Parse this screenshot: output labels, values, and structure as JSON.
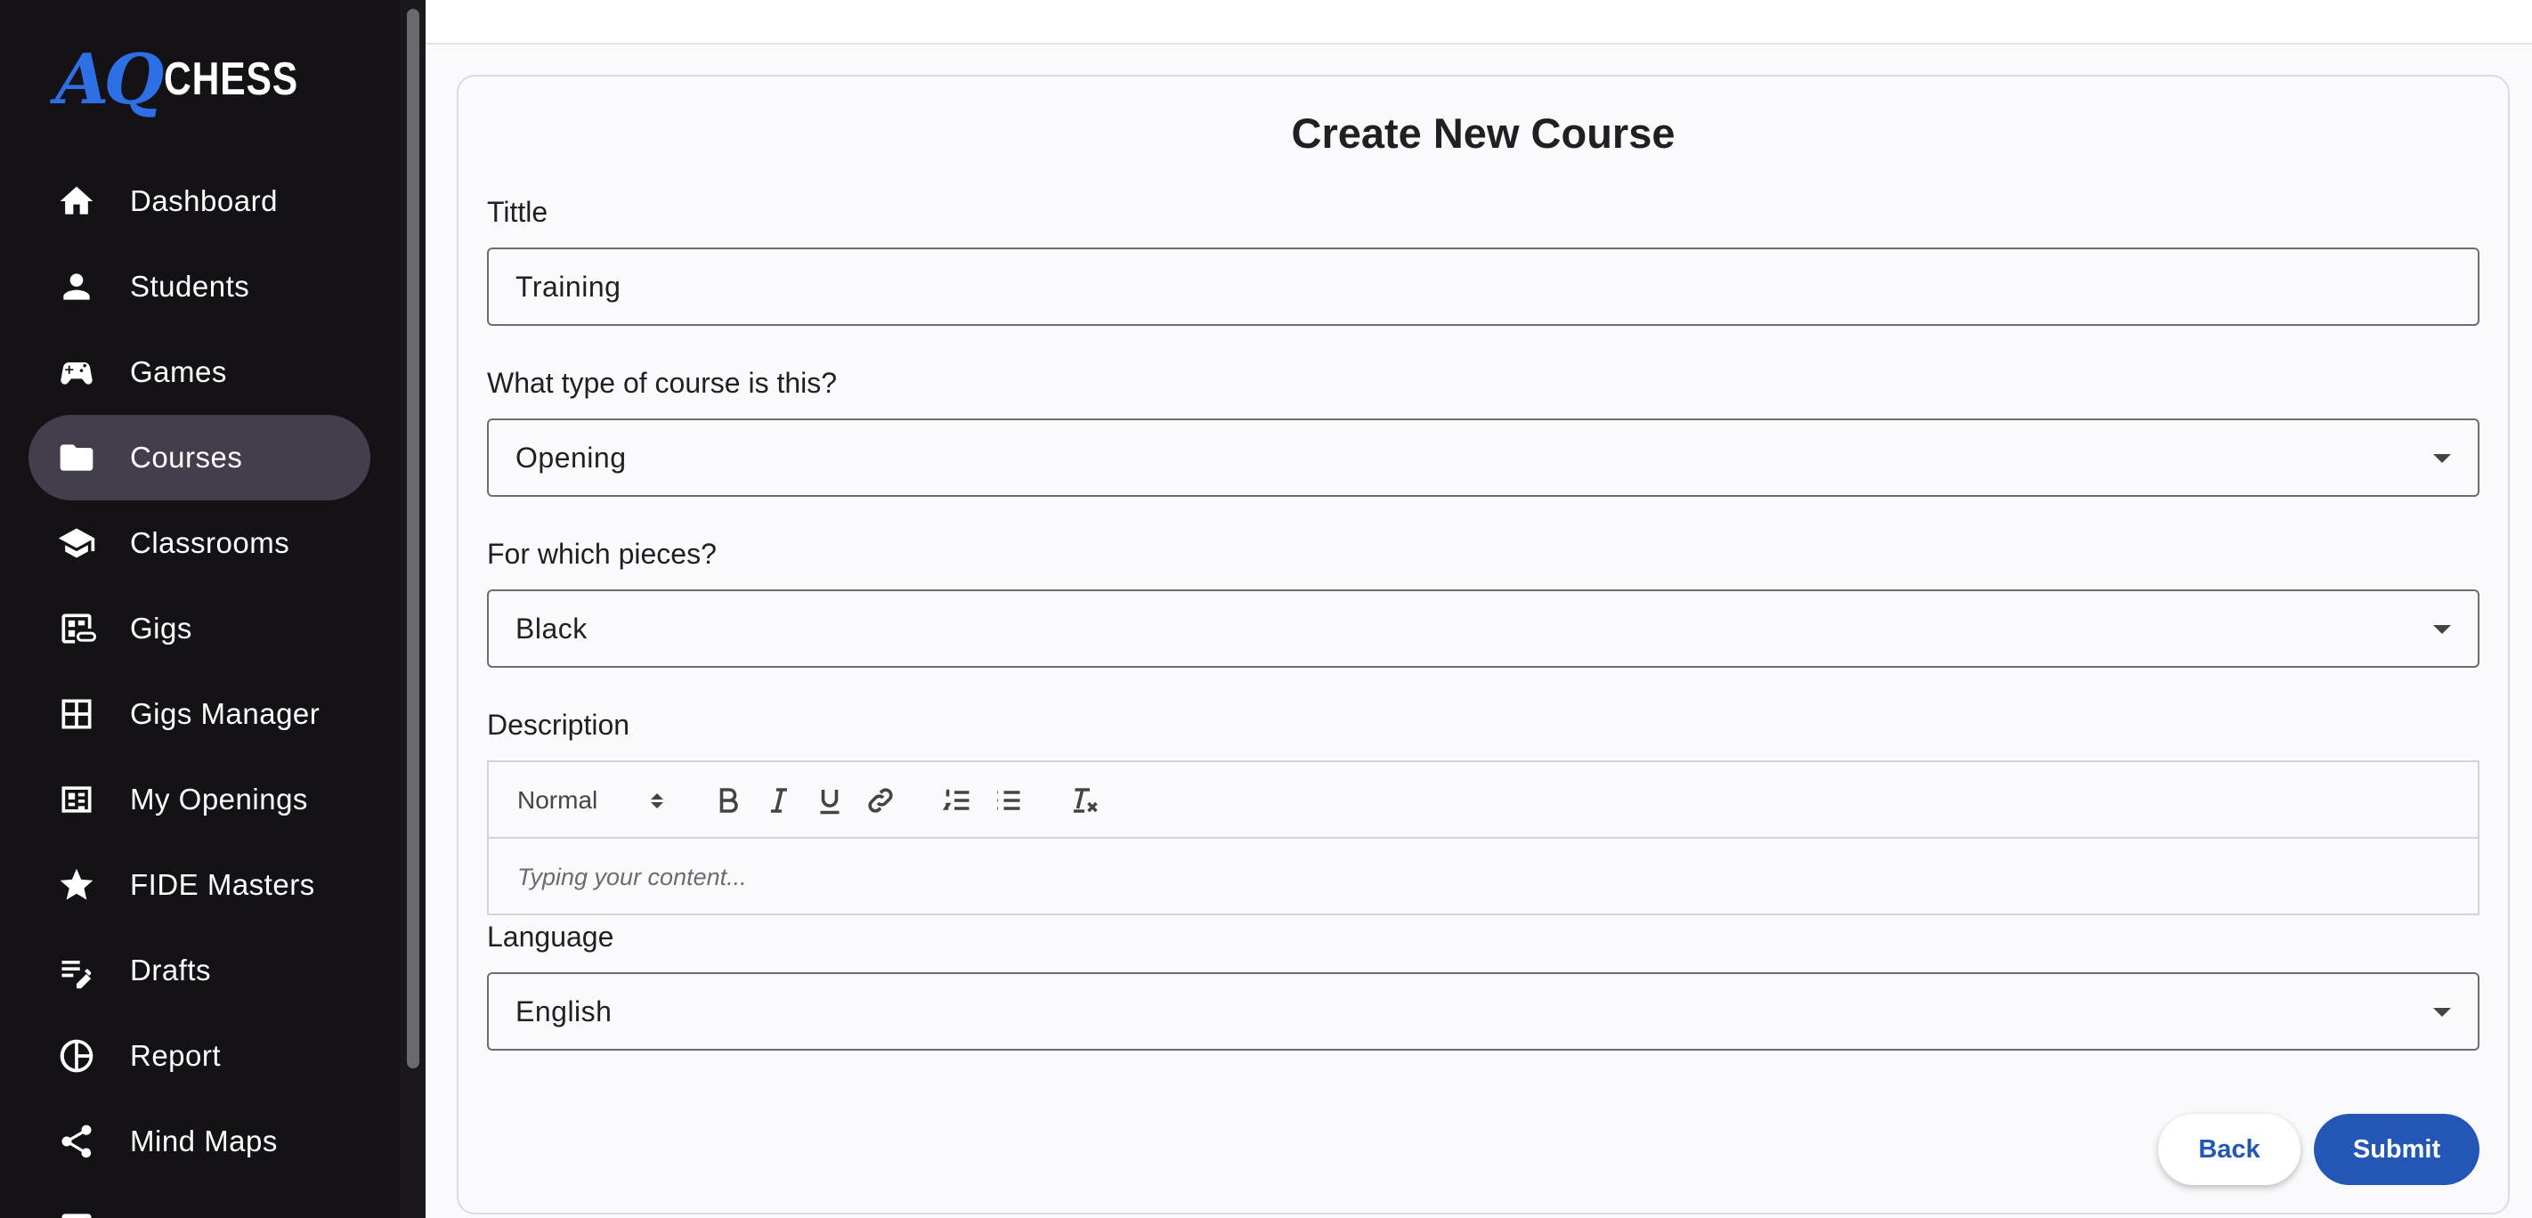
{
  "brand": {
    "logo_mark": "AQ",
    "logo_text": "CHESS",
    "accent": "#2f6fe6"
  },
  "sidebar": {
    "items": [
      {
        "label": "Dashboard",
        "icon": "home-icon",
        "active": false
      },
      {
        "label": "Students",
        "icon": "person-icon",
        "active": false
      },
      {
        "label": "Games",
        "icon": "gamepad-icon",
        "active": false
      },
      {
        "label": "Courses",
        "icon": "folder-icon",
        "active": true
      },
      {
        "label": "Classrooms",
        "icon": "school-icon",
        "active": false
      },
      {
        "label": "Gigs",
        "icon": "gigs-link-icon",
        "active": false
      },
      {
        "label": "Gigs Manager",
        "icon": "grid-icon",
        "active": false
      },
      {
        "label": "My Openings",
        "icon": "openings-icon",
        "active": false
      },
      {
        "label": "FIDE Masters",
        "icon": "star-icon",
        "active": false
      },
      {
        "label": "Drafts",
        "icon": "edit-note-icon",
        "active": false
      },
      {
        "label": "Report",
        "icon": "pie-chart-icon",
        "active": false
      },
      {
        "label": "Mind Maps",
        "icon": "share-icon",
        "active": false
      }
    ]
  },
  "form": {
    "title": "Create New Course",
    "title_field": {
      "label": "Tittle",
      "value": "Training"
    },
    "course_type": {
      "label": "What type of course is this?",
      "value": "Opening"
    },
    "pieces": {
      "label": "For which pieces?",
      "value": "Black"
    },
    "description": {
      "label": "Description",
      "format_value": "Normal",
      "placeholder": "Typing your content...",
      "toolbar": [
        "bold-icon",
        "italic-icon",
        "underline-icon",
        "link-icon",
        "ordered-list-icon",
        "bullet-list-icon",
        "clear-format-icon"
      ]
    },
    "language": {
      "label": "Language",
      "value": "English"
    },
    "back_label": "Back",
    "submit_label": "Submit"
  },
  "colors": {
    "sidebar_bg": "#141216",
    "active_item_bg": "#433d4c",
    "primary_button": "#2457b5"
  }
}
